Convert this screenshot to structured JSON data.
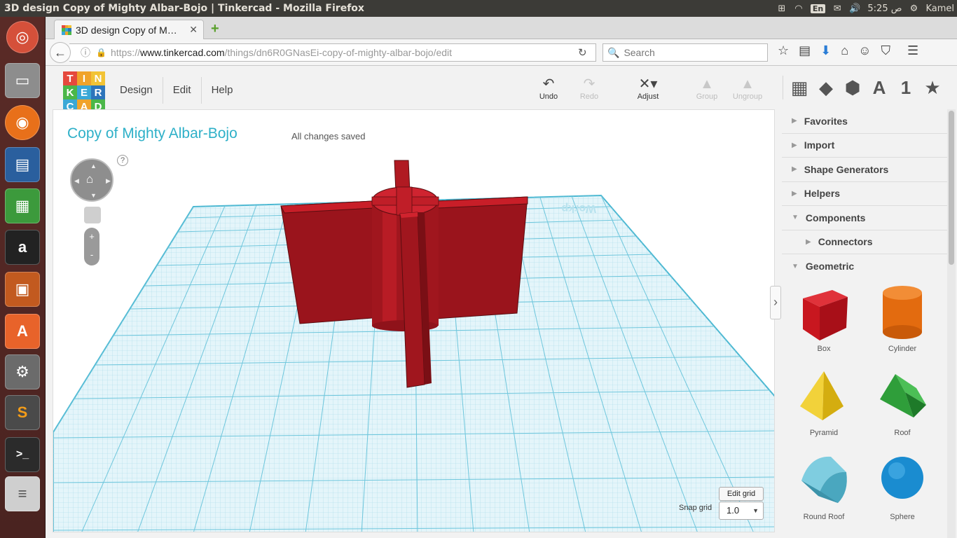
{
  "os": {
    "window_title": "3D design Copy of Mighty Albar-Bojo | Tinkercad - Mozilla Firefox",
    "keyboard_layout": "En",
    "time": "5:25 ص",
    "user": "Kamel",
    "launcher_icons": [
      "ubuntu-icon",
      "files-icon",
      "firefox-icon",
      "writer-icon",
      "calc-icon",
      "amazon-icon",
      "impress-icon",
      "software-center-icon",
      "settings-icon",
      "sublime-icon",
      "terminal-icon",
      "drive-icon"
    ]
  },
  "browser": {
    "tab_title": "3D design Copy of M…",
    "url_prefix": "https://",
    "url_domain": "www.tinkercad.com",
    "url_path": "/things/dn6R0GNasEi-copy-of-mighty-albar-bojo/edit",
    "search_placeholder": "Search"
  },
  "app": {
    "logo_letters": [
      "T",
      "I",
      "N",
      "K",
      "E",
      "R",
      "C",
      "A",
      "D"
    ],
    "logo_colors": [
      "#e5493d",
      "#f0a32b",
      "#f2c335",
      "#4bb749",
      "#3aa8d6",
      "#2d75bb",
      "#3aa8d6",
      "#f0a32b",
      "#4bb749"
    ],
    "menus": [
      "Design",
      "Edit",
      "Help"
    ],
    "toolbar": {
      "undo": "Undo",
      "redo": "Redo",
      "adjust": "Adjust",
      "group": "Group",
      "ungroup": "Ungroup"
    },
    "design_title": "Copy of Mighty Albar-Bojo",
    "save_status": "All changes saved",
    "help_mark": "?",
    "zoom_plus": "+",
    "zoom_minus": "-",
    "edit_grid": "Edit grid",
    "snap_grid_label": "Snap grid",
    "snap_grid_value": "1.0",
    "workplane_text": "Workp",
    "right_tabs": [
      "grid-icon",
      "cube-icon",
      "polyhedron-icon",
      "A",
      "1",
      "star-icon"
    ],
    "panel_sections": [
      {
        "label": "Favorites",
        "expanded": false
      },
      {
        "label": "Import",
        "expanded": false
      },
      {
        "label": "Shape Generators",
        "expanded": false
      },
      {
        "label": "Helpers",
        "expanded": false
      },
      {
        "label": "Components",
        "expanded": true
      },
      {
        "label": "Connectors",
        "expanded": false,
        "sub": true
      },
      {
        "label": "Geometric",
        "expanded": true
      }
    ],
    "shapes": [
      {
        "name": "Box",
        "color": "#c8171f"
      },
      {
        "name": "Cylinder",
        "color": "#e36b0f"
      },
      {
        "name": "Pyramid",
        "color": "#e8c51a"
      },
      {
        "name": "Roof",
        "color": "#2f9e3a"
      },
      {
        "name": "Round Roof",
        "color": "#5bb8cf"
      },
      {
        "name": "Sphere",
        "color": "#1a8cd0"
      }
    ],
    "accent_color": "#2eb0c8"
  }
}
